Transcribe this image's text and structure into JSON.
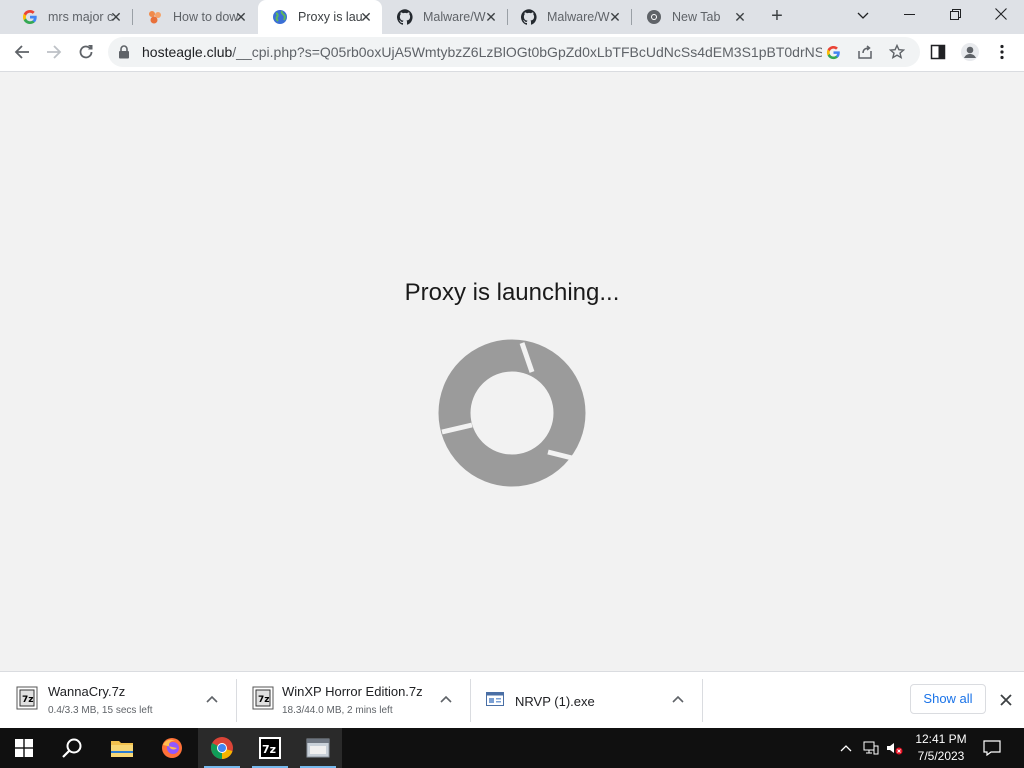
{
  "tabs": [
    {
      "title": "mrs major c",
      "icon": "google-icon",
      "active": false
    },
    {
      "title": "How to dow",
      "icon": "site-orange-icon",
      "active": false
    },
    {
      "title": "Proxy is lau",
      "icon": "globe-icon",
      "active": true
    },
    {
      "title": "Malware/W",
      "icon": "github-icon",
      "active": false
    },
    {
      "title": "Malware/W",
      "icon": "github-icon",
      "active": false
    },
    {
      "title": "New Tab",
      "icon": "chrome-icon",
      "active": false
    }
  ],
  "omnibox": {
    "domain": "hosteagle.club",
    "path": "/__cpi.php?s=Q05rb0oxUjA5WmtybzZ6LzBlOGt0bGpZd0xLbTFBcUdNcSs4dEM3S1pBT0drNS..."
  },
  "page": {
    "message": "Proxy is launching..."
  },
  "downloads": {
    "items": [
      {
        "name": "WannaCry.7z",
        "status": "0.4/3.3 MB, 15 secs left",
        "icon": "archive-7z-icon"
      },
      {
        "name": "WinXP Horror Edition.7z",
        "status": "18.3/44.0 MB, 2 mins left",
        "icon": "archive-7z-icon"
      },
      {
        "name": "NRVP (1).exe",
        "status": "",
        "icon": "exe-file-icon"
      }
    ],
    "show_all_label": "Show all"
  },
  "taskbar": {
    "apps": [
      "start-icon",
      "search-icon",
      "file-explorer-icon",
      "firefox-icon",
      "chrome-icon",
      "7zip-icon",
      "app-window-icon"
    ],
    "time": "12:41 PM",
    "date": "7/5/2023"
  }
}
